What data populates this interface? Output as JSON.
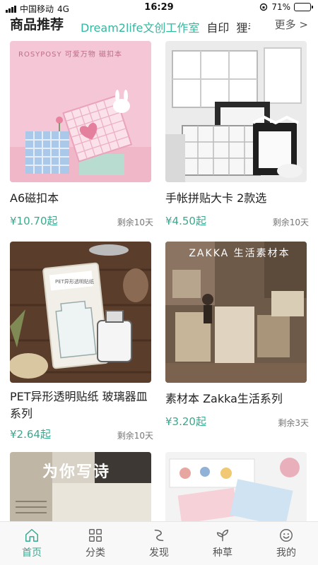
{
  "status": {
    "carrier": "中国移动",
    "network": "4G",
    "time": "16:29",
    "battery": "71%",
    "battery_level": 0.71
  },
  "header": {
    "title": "商品推荐",
    "tabs": [
      "Dream2life文创工作室",
      "自印",
      "狸手帖"
    ],
    "active_tab": 0,
    "more": "更多 >"
  },
  "products": [
    {
      "name": "A6磁扣本",
      "price": "¥10.70起",
      "remaining": "剩余10天",
      "image_text": "ROSYPOSY 可爱万物 磁扣本"
    },
    {
      "name": "手帐拼贴大卡 2款选",
      "price": "¥4.50起",
      "remaining": "剩余10天",
      "image_text": ""
    },
    {
      "name": "PET异形透明贴纸 玻璃器皿系列",
      "price": "¥2.64起",
      "remaining": "剩余10天",
      "image_text": "PET异形透明贴纸"
    },
    {
      "name": "素材本 Zakka生活系列",
      "price": "¥3.20起",
      "remaining": "剩余3天",
      "image_text": "ZAKKA 生活素材本"
    },
    {
      "name": "",
      "price": "",
      "remaining": "",
      "image_text": "为你写诗"
    },
    {
      "name": "",
      "price": "",
      "remaining": "",
      "image_text": ""
    }
  ],
  "nav": [
    {
      "label": "首页",
      "icon": "home-icon"
    },
    {
      "label": "分类",
      "icon": "grid-icon"
    },
    {
      "label": "发现",
      "icon": "discover-icon"
    },
    {
      "label": "种草",
      "icon": "sprout-icon"
    },
    {
      "label": "我的",
      "icon": "smile-icon"
    }
  ],
  "colors": {
    "accent": "#3aa98f",
    "tab_active": "#34b8a0",
    "nav_bg": "#f8f8f8"
  }
}
